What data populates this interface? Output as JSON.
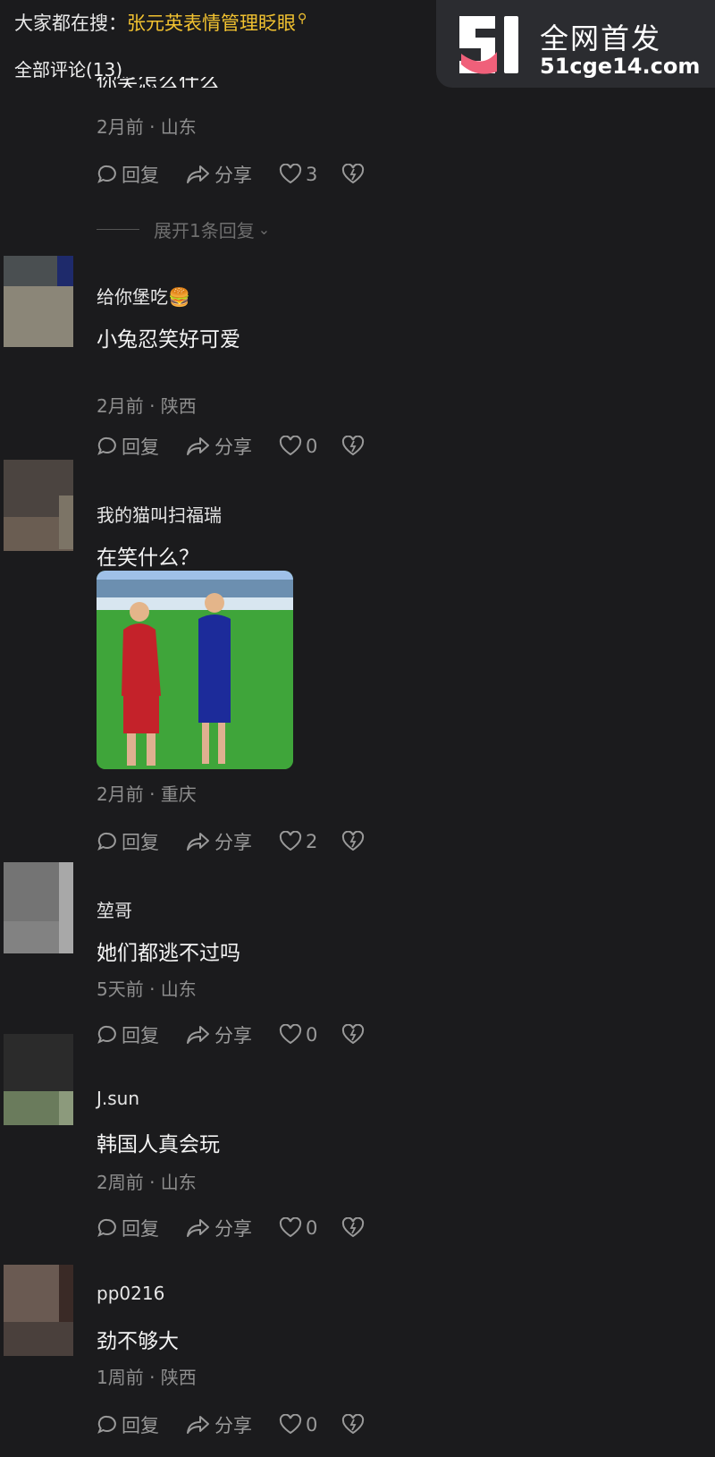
{
  "header": {
    "search_prefix": "大家都在搜：",
    "search_keyword": "张元英表情管理眨眼",
    "comments_title": "全部评论(13)"
  },
  "watermark": {
    "title": "全网首发",
    "url": "51cge14.com"
  },
  "actions": {
    "reply": "回复",
    "share": "分享"
  },
  "first_comment": {
    "text_cut": "你笑怎么什么",
    "meta": "2月前 · 山东",
    "likes": "3",
    "expand_label": "展开1条回复"
  },
  "comments": [
    {
      "author": "给你堡吃🍔",
      "text": "小兔忍笑好可爱",
      "meta": "2月前 · 陕西",
      "likes": "0"
    },
    {
      "author": "我的猫叫扫福瑞",
      "text": "在笑什么？",
      "meta": "2月前 · 重庆",
      "likes": "2"
    },
    {
      "author": "堃哥",
      "text": "她们都逃不过吗",
      "meta": "5天前 · 山东",
      "likes": "0"
    },
    {
      "author": "J.sun",
      "text": "韩国人真会玩",
      "meta": "2周前 · 山东",
      "likes": "0"
    },
    {
      "author": "pp0216",
      "text": "劲不够大",
      "meta": "1周前 · 陕西",
      "likes": "0"
    }
  ],
  "colors": {
    "background": "#1b1b1d",
    "keyword": "#f2c230",
    "muted": "#8e8e8e"
  }
}
